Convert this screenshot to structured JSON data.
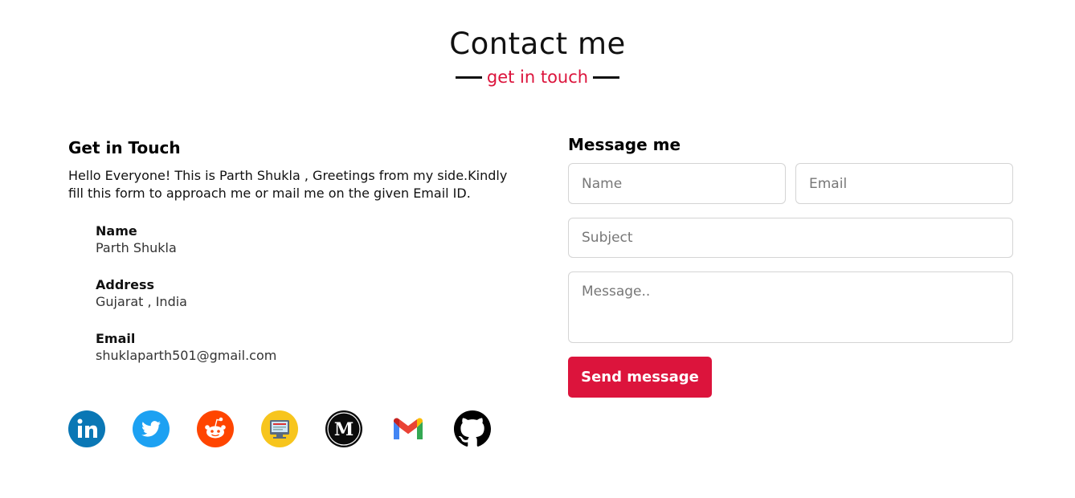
{
  "header": {
    "title": "Contact me",
    "subtitle": "get in touch"
  },
  "left": {
    "heading": "Get in Touch",
    "intro": "Hello Everyone! This is Parth Shukla , Greetings from my side.Kindly fill this form to approach me or mail me on the given Email ID.",
    "info": [
      {
        "label": "Name",
        "value": "Parth Shukla"
      },
      {
        "label": "Address",
        "value": "Gujarat , India"
      },
      {
        "label": "Email",
        "value": "shuklaparth501@gmail.com"
      }
    ]
  },
  "socials": [
    {
      "icon": "linkedin-icon",
      "color": "#0a77b5"
    },
    {
      "icon": "twitter-icon",
      "color": "#1da1f2"
    },
    {
      "icon": "reddit-icon",
      "color": "#ff4500"
    },
    {
      "icon": "blog-icon",
      "color": "#f7c51d"
    },
    {
      "icon": "medium-icon",
      "color": "#000000"
    },
    {
      "icon": "gmail-icon",
      "color": "#ea4335"
    },
    {
      "icon": "github-icon",
      "color": "#000000"
    }
  ],
  "form": {
    "heading": "Message me",
    "name_placeholder": "Name",
    "email_placeholder": "Email",
    "subject_placeholder": "Subject",
    "message_placeholder": "Message..",
    "send_label": "Send message"
  },
  "colors": {
    "accent": "#dc143c"
  }
}
